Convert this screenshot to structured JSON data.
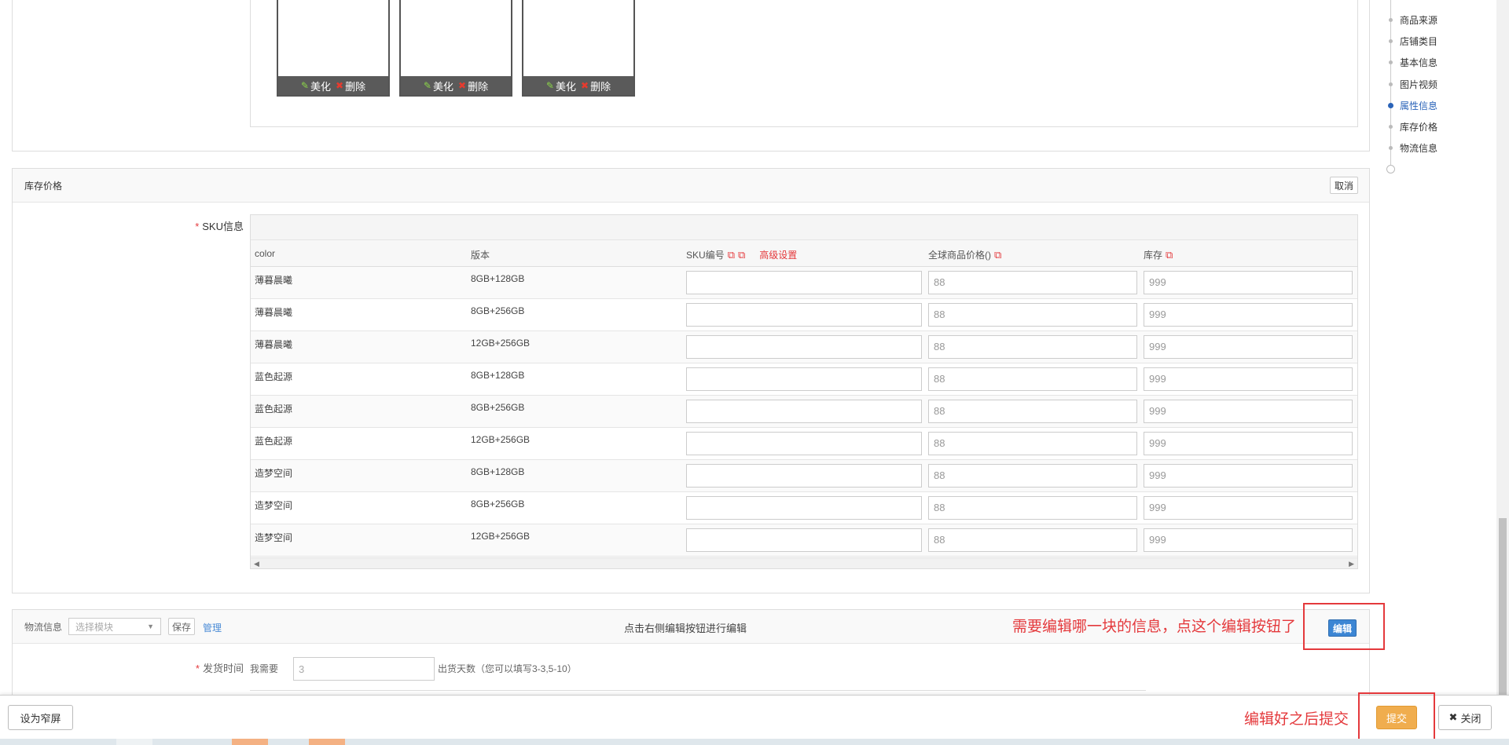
{
  "images": {
    "thumbnails": [
      {
        "beautify": "美化",
        "delete": "删除"
      },
      {
        "beautify": "美化",
        "delete": "删除"
      },
      {
        "beautify": "美化",
        "delete": "删除"
      }
    ]
  },
  "stock": {
    "title": "库存价格",
    "cancel": "取消",
    "sku_label": "SKU信息",
    "required_mark": "*",
    "columns": {
      "color": "color",
      "version": "版本",
      "sku_code": "SKU编号",
      "advanced": "高级设置",
      "global_price": "全球商品价格()",
      "inventory": "库存"
    },
    "rows": [
      {
        "color": "薄暮晨曦",
        "version": "8GB+128GB",
        "sku": "",
        "price": "88",
        "stock": "999"
      },
      {
        "color": "薄暮晨曦",
        "version": "8GB+256GB",
        "sku": "",
        "price": "88",
        "stock": "999"
      },
      {
        "color": "薄暮晨曦",
        "version": "12GB+256GB",
        "sku": "",
        "price": "88",
        "stock": "999"
      },
      {
        "color": "蓝色起源",
        "version": "8GB+128GB",
        "sku": "",
        "price": "88",
        "stock": "999"
      },
      {
        "color": "蓝色起源",
        "version": "8GB+256GB",
        "sku": "",
        "price": "88",
        "stock": "999"
      },
      {
        "color": "蓝色起源",
        "version": "12GB+256GB",
        "sku": "",
        "price": "88",
        "stock": "999"
      },
      {
        "color": "造梦空间",
        "version": "8GB+128GB",
        "sku": "",
        "price": "88",
        "stock": "999"
      },
      {
        "color": "造梦空间",
        "version": "8GB+256GB",
        "sku": "",
        "price": "88",
        "stock": "999"
      },
      {
        "color": "造梦空间",
        "version": "12GB+256GB",
        "sku": "",
        "price": "88",
        "stock": "999"
      }
    ]
  },
  "logistics": {
    "title": "物流信息",
    "select_placeholder": "选择模块",
    "save": "保存",
    "manage": "管理",
    "hint": "点击右侧编辑按钮进行编辑",
    "edit": "编辑",
    "annotation": "需要编辑哪一块的信息，点这个编辑按钮了",
    "ship_label": "发货时间",
    "need_prefix": "我需要",
    "days_value": "3",
    "days_suffix": "出货天数（您可以填写3-3,5-10）"
  },
  "sidenav": {
    "items": [
      "商品来源",
      "店铺类目",
      "基本信息",
      "图片视频",
      "属性信息",
      "库存价格",
      "物流信息"
    ],
    "active": "属性信息"
  },
  "bottom": {
    "narrow": "设为窄屏",
    "annotation": "编辑好之后提交",
    "submit": "提交",
    "close": "关闭"
  },
  "colors": {
    "accent_blue": "#3c86d4",
    "submit_orange": "#f0ad4e",
    "annotation_red": "#e4393c"
  }
}
